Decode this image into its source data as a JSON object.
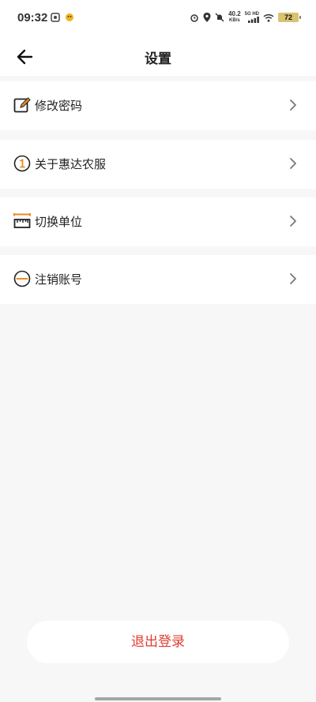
{
  "status_bar": {
    "time": "09:32",
    "net_speed_value": "40.2",
    "net_speed_unit": "KB/s",
    "signal_label": "5G HD",
    "battery": "72",
    "icons": [
      "gallery-icon",
      "app-icon",
      "alarm-icon",
      "location-icon",
      "mute-icon",
      "signal-icon",
      "wifi-icon",
      "battery-icon"
    ]
  },
  "header": {
    "title": "设置",
    "back_icon": "arrow-left-icon"
  },
  "menu": [
    {
      "label": "修改密码",
      "icon": "edit-icon"
    },
    {
      "label": "关于惠达农服",
      "icon": "info-circle-icon"
    },
    {
      "label": "切换单位",
      "icon": "ruler-icon"
    },
    {
      "label": "注销账号",
      "icon": "minus-circle-icon"
    }
  ],
  "logout": {
    "label": "退出登录"
  },
  "colors": {
    "accent_orange": "#f08a1f",
    "logout_red": "#e03c31",
    "background": "#f7f7f7"
  }
}
